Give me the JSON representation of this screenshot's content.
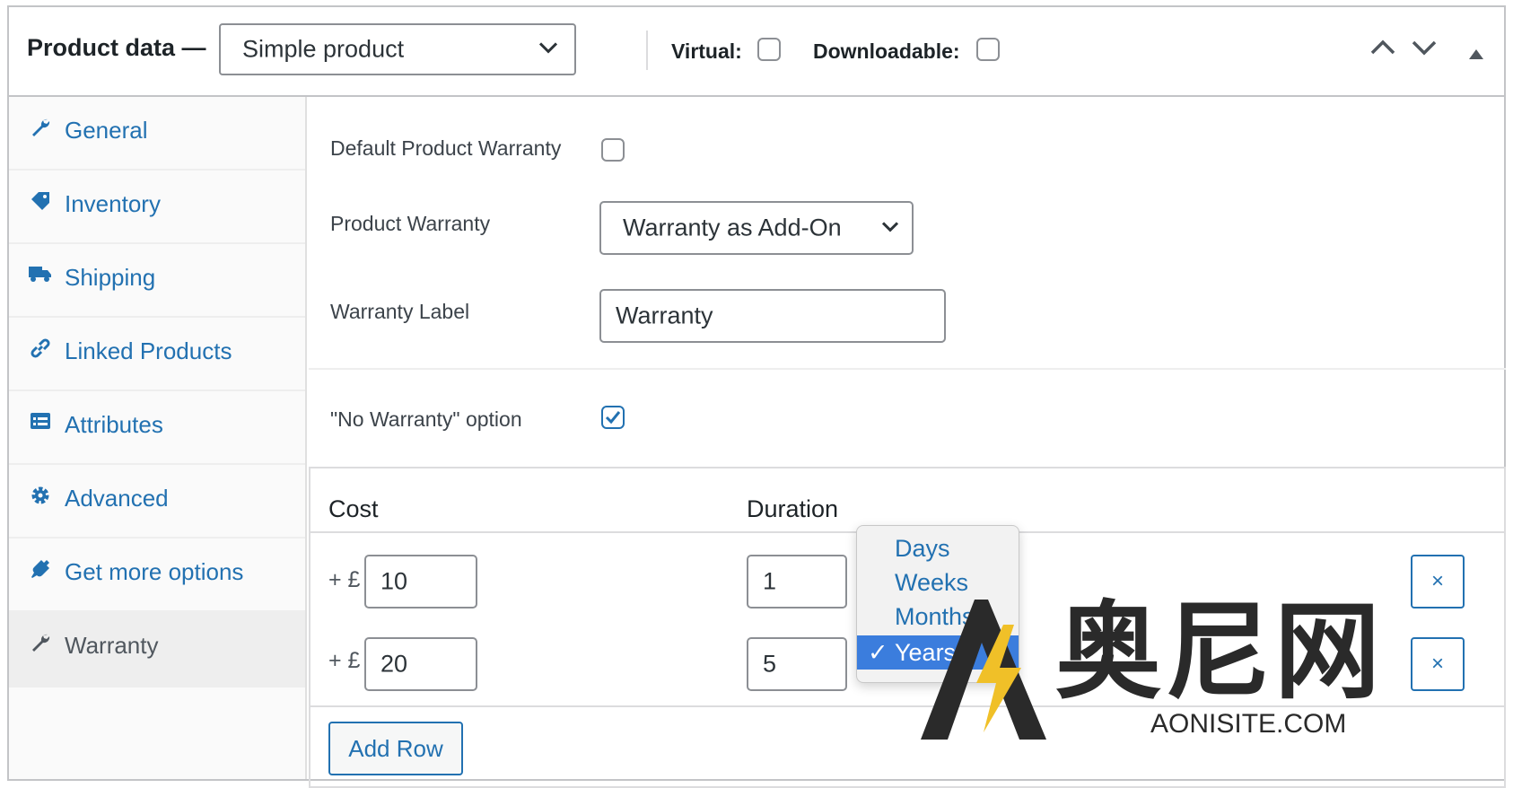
{
  "header": {
    "title": "Product data —",
    "product_type": "Simple product",
    "virtual_label": "Virtual:",
    "downloadable_label": "Downloadable:"
  },
  "sidebar": {
    "items": [
      {
        "label": "General",
        "icon": "wrench-icon"
      },
      {
        "label": "Inventory",
        "icon": "tag-icon"
      },
      {
        "label": "Shipping",
        "icon": "truck-icon"
      },
      {
        "label": "Linked Products",
        "icon": "link-icon"
      },
      {
        "label": "Attributes",
        "icon": "list-icon"
      },
      {
        "label": "Advanced",
        "icon": "gear-icon"
      },
      {
        "label": "Get more options",
        "icon": "plugin-icon"
      },
      {
        "label": "Warranty",
        "icon": "wrench-icon"
      }
    ]
  },
  "form": {
    "default_warranty_label": "Default Product Warranty",
    "product_warranty_label": "Product Warranty",
    "product_warranty_value": "Warranty as Add-On",
    "warranty_label_label": "Warranty Label",
    "warranty_label_value": "Warranty",
    "no_warranty_label": "\"No Warranty\" option"
  },
  "table": {
    "cost_header": "Cost",
    "duration_header": "Duration",
    "currency_prefix": "+ £",
    "rows": [
      {
        "cost": "10",
        "duration": "1"
      },
      {
        "cost": "20",
        "duration": "5"
      }
    ],
    "remove_label": "×",
    "add_row_label": "Add Row"
  },
  "duration_dropdown": {
    "options": [
      "Days",
      "Weeks",
      "Months",
      "Years"
    ],
    "selected": "Years",
    "check": "✓"
  },
  "watermark": {
    "text_cn": "奥尼网",
    "text_en": "AONISITE.COM"
  }
}
